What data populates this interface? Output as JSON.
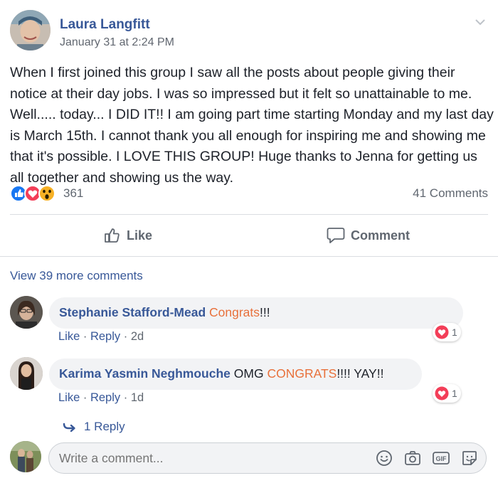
{
  "post": {
    "author": "Laura Langfitt",
    "timestamp": "January 31 at 2:24 PM",
    "text": "When I first joined this group I saw all the posts about people giving their notice at their day jobs. I was so impressed but it felt so unattainable to me. Well..... today... I DID IT!! I am going part time starting Monday and my last day is March 15th. I cannot thank you all enough for inspiring me and showing me that it's possible. I LOVE THIS GROUP! Huge thanks to Jenna for getting us all together and showing us the way.",
    "reactions": {
      "icons": [
        "like-icon",
        "love-icon",
        "wow-icon"
      ],
      "count": "361"
    },
    "comments_count": "41 Comments"
  },
  "actions": {
    "like_label": "Like",
    "comment_label": "Comment"
  },
  "view_more": "View 39 more comments",
  "comments": [
    {
      "name": "Stephanie Stafford-Mead",
      "highlight": "Congrats",
      "rest": "!!!",
      "like": "Like",
      "reply": "Reply",
      "age": "2d",
      "reaction_count": "1"
    },
    {
      "name": "Karima Yasmin Neghmouche",
      "pre": "OMG",
      "highlight": "CONGRATS",
      "rest": "!!!! YAY!!",
      "like": "Like",
      "reply": "Reply",
      "age": "1d",
      "reaction_count": "1"
    }
  ],
  "replies_link": "1 Reply",
  "composer": {
    "placeholder": "Write a comment...",
    "icons": [
      "emoji-icon",
      "camera-icon",
      "gif-icon",
      "sticker-icon"
    ]
  },
  "colors": {
    "link": "#385898",
    "highlight": "#e8703a",
    "muted": "#606770",
    "love": "#f33e58",
    "like": "#1877f2",
    "wow": "#f7b125"
  }
}
